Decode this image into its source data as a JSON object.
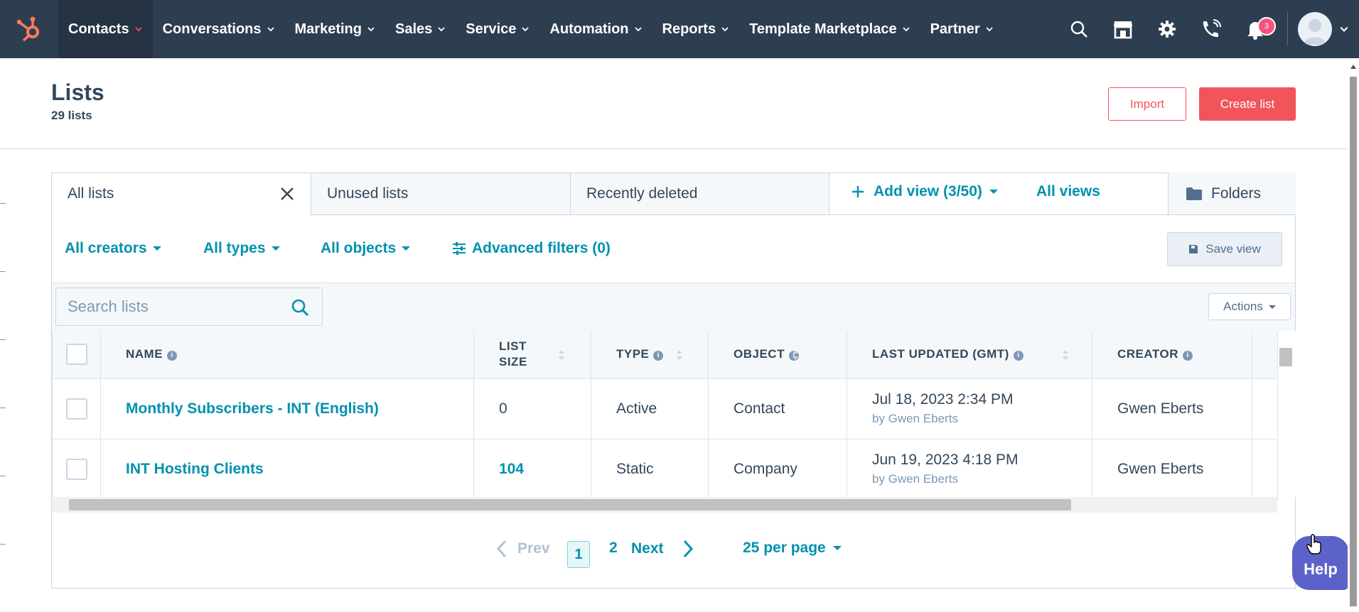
{
  "nav": {
    "items": [
      {
        "label": "Contacts"
      },
      {
        "label": "Conversations"
      },
      {
        "label": "Marketing"
      },
      {
        "label": "Sales"
      },
      {
        "label": "Service"
      },
      {
        "label": "Automation"
      },
      {
        "label": "Reports"
      },
      {
        "label": "Template Marketplace"
      },
      {
        "label": "Partner"
      }
    ],
    "notification_count": "3"
  },
  "header": {
    "title": "Lists",
    "subtitle": "29 lists",
    "import_label": "Import",
    "create_label": "Create list"
  },
  "tabs": [
    {
      "label": "All lists"
    },
    {
      "label": "Unused lists"
    },
    {
      "label": "Recently deleted"
    }
  ],
  "views": {
    "add_view_label": "Add view (3/50)",
    "all_views_label": "All views",
    "folders_label": "Folders"
  },
  "filters": {
    "creators": "All creators",
    "types": "All types",
    "objects": "All objects",
    "advanced": "Advanced filters (0)",
    "save_view": "Save view"
  },
  "search": {
    "placeholder": "Search lists"
  },
  "actions_label": "Actions",
  "table": {
    "headers": {
      "name": "NAME",
      "list_size_1": "LIST",
      "list_size_2": "SIZE",
      "type": "TYPE",
      "object": "OBJECT",
      "last_updated": "LAST UPDATED (GMT)",
      "creator": "CREATOR"
    },
    "rows": [
      {
        "name": "Monthly Subscribers - INT (English)",
        "size": "0",
        "type": "Active",
        "object": "Contact",
        "updated": "Jul 18, 2023 2:34 PM",
        "updated_by": "by Gwen Eberts",
        "creator": "Gwen Eberts"
      },
      {
        "name": "INT Hosting Clients",
        "size": "104",
        "type": "Static",
        "object": "Company",
        "updated": "Jun 19, 2023 4:18 PM",
        "updated_by": "by Gwen Eberts",
        "creator": "Gwen Eberts"
      }
    ]
  },
  "pagination": {
    "prev": "Prev",
    "page1": "1",
    "page2": "2",
    "next": "Next",
    "per_page": "25 per page"
  },
  "help_label": "Help",
  "colors": {
    "nav_bg": "#2d3e50",
    "accent": "#0091ae",
    "primary_button": "#f2545b",
    "logo": "#ff7a59",
    "help": "#5c62c9"
  }
}
